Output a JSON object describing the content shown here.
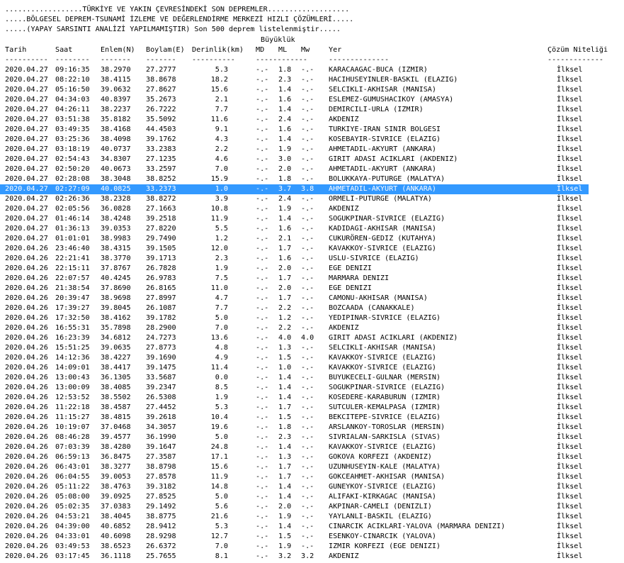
{
  "header": {
    "line1": "..................TÜRKİYE VE YAKIN ÇEVRESİNDEKİ SON DEPREMLER...................",
    "line2": ".....BÖLGESEL DEPREM-TSUNAMİ İZLEME VE DEĞERLENDİRME MERKEZİ HIZLI ÇÖZÜMLERİ.....",
    "line3": ".....(YAPAY SARSINTI ANALİZİ YAPILMAMIŞTIR) Son 500 deprem listelenmiştir....."
  },
  "columns": {
    "magnitude_group": "Büyüklük",
    "date": "Tarih",
    "time": "Saat",
    "lat": "Enlem(N)",
    "lon": "Boylam(E)",
    "depth": "Derinlik(km)",
    "md": "MD",
    "ml": "ML",
    "mw": "Mw",
    "place": "Yer",
    "quality": "Çözüm Niteliği"
  },
  "separators": {
    "date": "----------",
    "time": "--------",
    "lat": "-------",
    "lon": "-------",
    "depth": "----------",
    "mag": "------------",
    "place": "--------------",
    "quality": "-------------"
  },
  "selected_index": 12,
  "rows": [
    [
      "2020.04.27",
      "09:16:35",
      "38.2970",
      "27.2777",
      "5.3",
      "-.-",
      "1.8",
      "-.-",
      "KARACAAGAC-BUCA (IZMIR)",
      "İlksel"
    ],
    [
      "2020.04.27",
      "08:22:10",
      "38.4115",
      "38.8678",
      "18.2",
      "-.-",
      "2.3",
      "-.-",
      "HACIHUSEYINLER-BASKIL (ELAZIG)",
      "İlksel"
    ],
    [
      "2020.04.27",
      "05:16:50",
      "39.0632",
      "27.8627",
      "15.6",
      "-.-",
      "1.4",
      "-.-",
      "SELCIKLI-AKHISAR (MANISA)",
      "İlksel"
    ],
    [
      "2020.04.27",
      "04:34:03",
      "40.8397",
      "35.2673",
      "2.1",
      "-.-",
      "1.6",
      "-.-",
      "ESLEMEZ-GUMUSHACIKOY (AMASYA)",
      "İlksel"
    ],
    [
      "2020.04.27",
      "04:26:11",
      "38.2237",
      "26.7222",
      "7.7",
      "-.-",
      "1.4",
      "-.-",
      "DEMIRCILI-URLA (IZMIR)",
      "İlksel"
    ],
    [
      "2020.04.27",
      "03:51:38",
      "35.8182",
      "35.5092",
      "11.6",
      "-.-",
      "2.4",
      "-.-",
      "AKDENIZ",
      "İlksel"
    ],
    [
      "2020.04.27",
      "03:49:35",
      "38.4168",
      "44.4503",
      "9.1",
      "-.-",
      "1.6",
      "-.-",
      "TURKIYE-IRAN SINIR BOLGESI",
      "İlksel"
    ],
    [
      "2020.04.27",
      "03:25:36",
      "38.4098",
      "39.1762",
      "4.3",
      "-.-",
      "1.4",
      "-.-",
      "KOSEBAYIR-SIVRICE (ELAZIG)",
      "İlksel"
    ],
    [
      "2020.04.27",
      "03:18:19",
      "40.0737",
      "33.2383",
      "2.2",
      "-.-",
      "1.9",
      "-.-",
      "AHMETADIL-AKYURT (ANKARA)",
      "İlksel"
    ],
    [
      "2020.04.27",
      "02:54:43",
      "34.8307",
      "27.1235",
      "4.6",
      "-.-",
      "3.0",
      "-.-",
      "GIRIT ADASI ACIKLARI (AKDENIZ)",
      "İlksel"
    ],
    [
      "2020.04.27",
      "02:50:20",
      "40.0673",
      "33.2597",
      "7.0",
      "-.-",
      "2.0",
      "-.-",
      "AHMETADIL-AKYURT (ANKARA)",
      "İlksel"
    ],
    [
      "2020.04.27",
      "02:28:08",
      "38.3048",
      "38.8252",
      "15.9",
      "-.-",
      "1.8",
      "-.-",
      "BOLUKKAYA-PUTURGE (MALATYA)",
      "İlksel"
    ],
    [
      "2020.04.27",
      "02:27:09",
      "40.0825",
      "33.2373",
      "1.0",
      "-.-",
      "3.7",
      "3.8",
      "AHMETADIL-AKYURT (ANKARA)",
      "İlksel"
    ],
    [
      "2020.04.27",
      "02:26:36",
      "38.2328",
      "38.8272",
      "3.9",
      "-.-",
      "2.4",
      "-.-",
      "ORMELI-PUTURGE (MALATYA)",
      "İlksel"
    ],
    [
      "2020.04.27",
      "02:05:56",
      "36.0828",
      "27.1663",
      "10.8",
      "-.-",
      "1.9",
      "-.-",
      "AKDENIZ",
      "İlksel"
    ],
    [
      "2020.04.27",
      "01:46:14",
      "38.4248",
      "39.2518",
      "11.9",
      "-.-",
      "1.4",
      "-.-",
      "SOGUKPINAR-SIVRICE (ELAZIG)",
      "İlksel"
    ],
    [
      "2020.04.27",
      "01:36:13",
      "39.0353",
      "27.8220",
      "5.5",
      "-.-",
      "1.6",
      "-.-",
      "KADIDAGI-AKHISAR (MANISA)",
      "İlksel"
    ],
    [
      "2020.04.27",
      "01:01:01",
      "38.9983",
      "29.7490",
      "1.2",
      "-.-",
      "2.1",
      "-.-",
      "CUKURÖREN-GEDIZ (KUTAHYA)",
      "İlksel"
    ],
    [
      "2020.04.26",
      "23:46:40",
      "38.4315",
      "39.1505",
      "12.0",
      "-.-",
      "1.7",
      "-.-",
      "KAVAKKOY-SIVRICE (ELAZIG)",
      "İlksel"
    ],
    [
      "2020.04.26",
      "22:21:41",
      "38.3770",
      "39.1713",
      "2.3",
      "-.-",
      "1.6",
      "-.-",
      "USLU-SIVRICE (ELAZIG)",
      "İlksel"
    ],
    [
      "2020.04.26",
      "22:15:11",
      "37.8767",
      "26.7828",
      "1.9",
      "-.-",
      "2.0",
      "-.-",
      "EGE DENIZI",
      "İlksel"
    ],
    [
      "2020.04.26",
      "22:07:57",
      "40.4245",
      "26.9783",
      "7.5",
      "-.-",
      "1.7",
      "-.-",
      "MARMARA DENIZI",
      "İlksel"
    ],
    [
      "2020.04.26",
      "21:38:54",
      "37.8690",
      "26.8165",
      "11.0",
      "-.-",
      "2.0",
      "-.-",
      "EGE DENIZI",
      "İlksel"
    ],
    [
      "2020.04.26",
      "20:39:47",
      "38.9698",
      "27.8997",
      "4.7",
      "-.-",
      "1.7",
      "-.-",
      "CAMONU-AKHISAR (MANISA)",
      "İlksel"
    ],
    [
      "2020.04.26",
      "17:39:27",
      "39.8045",
      "26.1087",
      "7.7",
      "-.-",
      "2.2",
      "-.-",
      "BOZCAADA (CANAKKALE)",
      "İlksel"
    ],
    [
      "2020.04.26",
      "17:32:50",
      "38.4162",
      "39.1782",
      "5.0",
      "-.-",
      "1.2",
      "-.-",
      "YEDIPINAR-SIVRICE (ELAZIG)",
      "İlksel"
    ],
    [
      "2020.04.26",
      "16:55:31",
      "35.7898",
      "28.2900",
      "7.0",
      "-.-",
      "2.2",
      "-.-",
      "AKDENIZ",
      "İlksel"
    ],
    [
      "2020.04.26",
      "16:23:39",
      "34.6812",
      "24.7273",
      "13.6",
      "-.-",
      "4.0",
      "4.0",
      "GIRIT ADASI ACIKLARI (AKDENIZ)",
      "İlksel"
    ],
    [
      "2020.04.26",
      "15:51:25",
      "39.0635",
      "27.8773",
      "4.8",
      "-.-",
      "1.3",
      "-.-",
      "SELCIKLI-AKHISAR (MANISA)",
      "İlksel"
    ],
    [
      "2020.04.26",
      "14:12:36",
      "38.4227",
      "39.1690",
      "4.9",
      "-.-",
      "1.5",
      "-.-",
      "KAVAKKOY-SIVRICE (ELAZIG)",
      "İlksel"
    ],
    [
      "2020.04.26",
      "14:09:01",
      "38.4417",
      "39.1475",
      "11.4",
      "-.-",
      "1.0",
      "-.-",
      "KAVAKKOY-SIVRICE (ELAZIG)",
      "İlksel"
    ],
    [
      "2020.04.26",
      "13:00:43",
      "36.1305",
      "33.5687",
      "0.0",
      "-.-",
      "1.4",
      "-.-",
      "BUYUKECELI-GULNAR (MERSIN)",
      "İlksel"
    ],
    [
      "2020.04.26",
      "13:00:09",
      "38.4085",
      "39.2347",
      "8.5",
      "-.-",
      "1.4",
      "-.-",
      "SOGUKPINAR-SIVRICE (ELAZIG)",
      "İlksel"
    ],
    [
      "2020.04.26",
      "12:53:52",
      "38.5502",
      "26.5308",
      "1.9",
      "-.-",
      "1.4",
      "-.-",
      "KOSEDERE-KARABURUN (IZMIR)",
      "İlksel"
    ],
    [
      "2020.04.26",
      "11:22:18",
      "38.4587",
      "27.4452",
      "5.3",
      "-.-",
      "1.7",
      "-.-",
      "SUTCULER-KEMALPASA (IZMIR)",
      "İlksel"
    ],
    [
      "2020.04.26",
      "11:15:27",
      "38.4815",
      "39.2618",
      "10.4",
      "-.-",
      "1.5",
      "-.-",
      "BEKCITEPE-SIVRICE (ELAZIG)",
      "İlksel"
    ],
    [
      "2020.04.26",
      "10:19:07",
      "37.0468",
      "34.3057",
      "19.6",
      "-.-",
      "1.8",
      "-.-",
      "ARSLANKOY-TOROSLAR (MERSIN)",
      "İlksel"
    ],
    [
      "2020.04.26",
      "08:46:28",
      "39.4577",
      "36.1990",
      "5.0",
      "-.-",
      "2.3",
      "-.-",
      "SIVRIALAN-SARKISLA (SIVAS)",
      "İlksel"
    ],
    [
      "2020.04.26",
      "07:03:39",
      "38.4280",
      "39.1647",
      "24.8",
      "-.-",
      "1.4",
      "-.-",
      "KAVAKKOY-SIVRICE (ELAZIG)",
      "İlksel"
    ],
    [
      "2020.04.26",
      "06:59:13",
      "36.8475",
      "27.3587",
      "17.1",
      "-.-",
      "1.3",
      "-.-",
      "GOKOVA KORFEZI (AKDENIZ)",
      "İlksel"
    ],
    [
      "2020.04.26",
      "06:43:01",
      "38.3277",
      "38.8798",
      "15.6",
      "-.-",
      "1.7",
      "-.-",
      "UZUNHUSEYIN-KALE (MALATYA)",
      "İlksel"
    ],
    [
      "2020.04.26",
      "06:04:55",
      "39.0053",
      "27.8578",
      "11.9",
      "-.-",
      "1.7",
      "-.-",
      "GOKCEAHMET-AKHISAR (MANISA)",
      "İlksel"
    ],
    [
      "2020.04.26",
      "05:11:22",
      "38.4763",
      "39.3182",
      "14.8",
      "-.-",
      "1.4",
      "-.-",
      "GUNEYKOY-SIVRICE (ELAZIG)",
      "İlksel"
    ],
    [
      "2020.04.26",
      "05:08:00",
      "39.0925",
      "27.8525",
      "5.0",
      "-.-",
      "1.4",
      "-.-",
      "ALIFAKI-KIRKAGAC (MANISA)",
      "İlksel"
    ],
    [
      "2020.04.26",
      "05:02:35",
      "37.0383",
      "29.1492",
      "5.6",
      "-.-",
      "2.0",
      "-.-",
      "AKPINAR-CAMELI (DENIZLI)",
      "İlksel"
    ],
    [
      "2020.04.26",
      "04:53:21",
      "38.4045",
      "38.8775",
      "21.6",
      "-.-",
      "1.9",
      "-.-",
      "YAYLANLI-BASKIL (ELAZIG)",
      "İlksel"
    ],
    [
      "2020.04.26",
      "04:39:00",
      "40.6852",
      "28.9412",
      "5.3",
      "-.-",
      "1.4",
      "-.-",
      "CINARCIK ACIKLARI-YALOVA (MARMARA DENIZI)",
      "İlksel"
    ],
    [
      "2020.04.26",
      "04:33:01",
      "40.6098",
      "28.9298",
      "12.7",
      "-.-",
      "1.5",
      "-.-",
      "ESENKOY-CINARCIK (YALOVA)",
      "İlksel"
    ],
    [
      "2020.04.26",
      "03:49:53",
      "38.6523",
      "26.6372",
      "7.0",
      "-.-",
      "1.9",
      "-.-",
      "IZMIR KORFEZI (EGE DENIZI)",
      "İlksel"
    ],
    [
      "2020.04.26",
      "03:17:45",
      "36.1118",
      "25.7655",
      "8.1",
      "-.-",
      "3.2",
      "3.2",
      "AKDENIZ",
      "İlksel"
    ]
  ]
}
